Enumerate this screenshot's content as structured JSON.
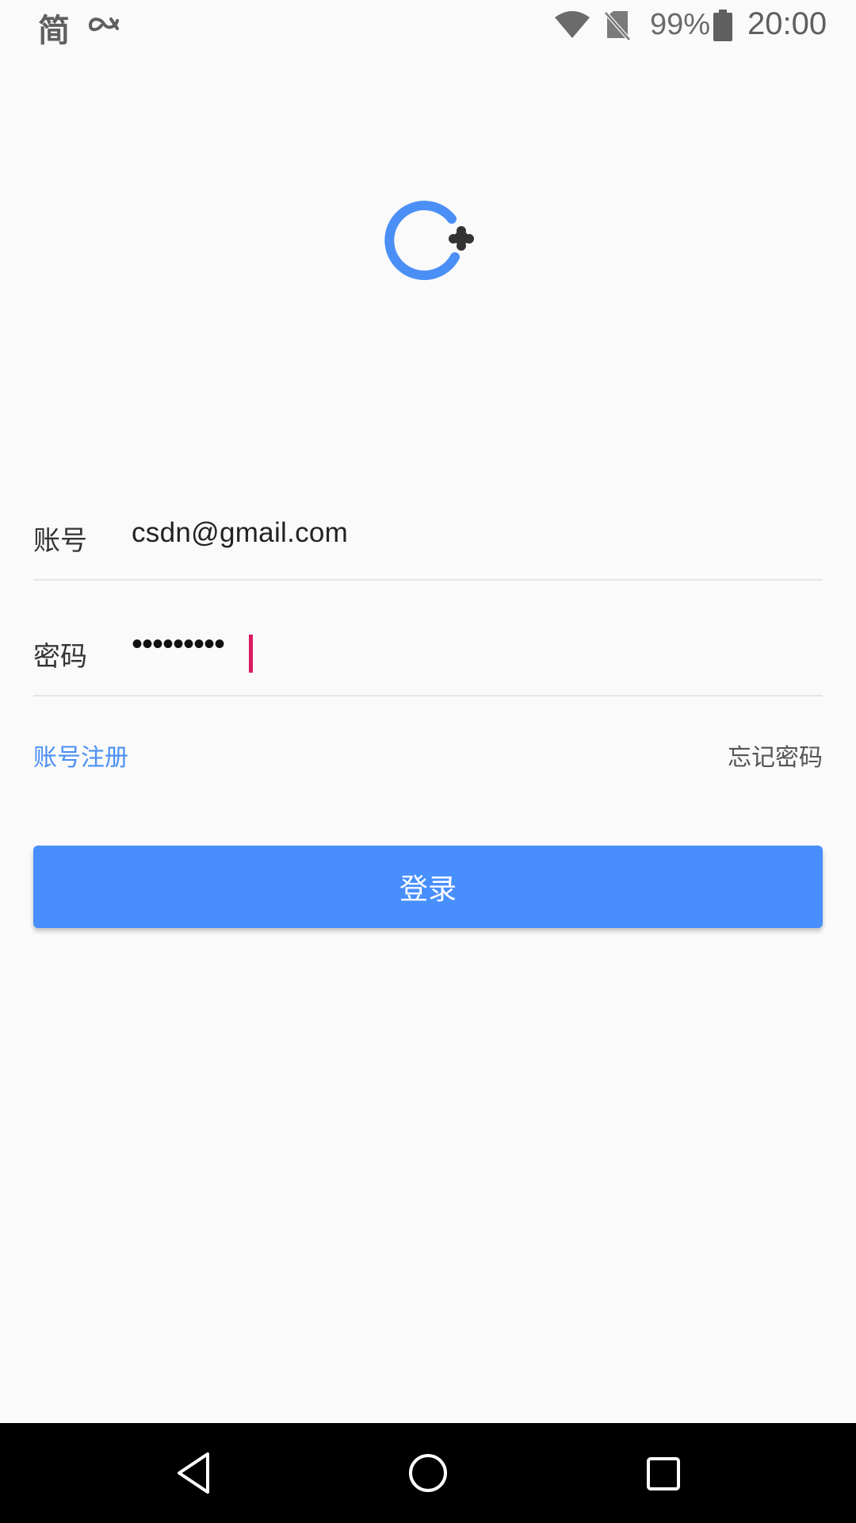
{
  "status_bar": {
    "input_method_char": "简",
    "battery_percent": "99%",
    "time": "20:00",
    "icons": [
      "infinity-icon",
      "wifi-icon",
      "no-sim-icon",
      "battery-icon"
    ]
  },
  "logo": {
    "icon": "app-logo-icon",
    "colors": {
      "ring": "#4a8ff5",
      "plus": "#333333"
    }
  },
  "form": {
    "account": {
      "label": "账号",
      "value": "csdn@gmail.com"
    },
    "password": {
      "label": "密码",
      "masked_value": "•••••••••"
    },
    "register_link": "账号注册",
    "forgot_link": "忘记密码",
    "login_button": "登录"
  },
  "colors": {
    "accent": "#488ffd",
    "cursor": "#d81b60",
    "background": "#fafafa"
  },
  "nav_bar": {
    "icons": [
      "back-icon",
      "home-icon",
      "recents-icon"
    ]
  }
}
